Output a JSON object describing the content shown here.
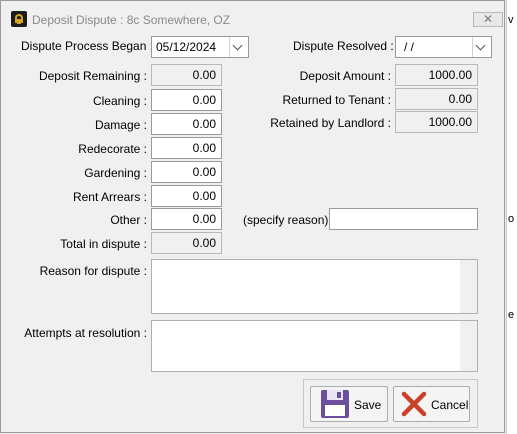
{
  "window": {
    "title": "Deposit Dispute : 8c Somewhere, OZ",
    "close_glyph": "✕"
  },
  "background": {
    "chars": [
      "v",
      "o",
      "e"
    ]
  },
  "dates": {
    "began_label": "Dispute Process Began :",
    "began_value": "05/12/2024",
    "resolved_label": "Dispute Resolved :",
    "resolved_value": " /  /"
  },
  "left": {
    "deposit_remaining": {
      "label": "Deposit Remaining :",
      "value": "0.00"
    },
    "cleaning": {
      "label": "Cleaning :",
      "value": "0.00"
    },
    "damage": {
      "label": "Damage :",
      "value": "0.00"
    },
    "redecorate": {
      "label": "Redecorate :",
      "value": "0.00"
    },
    "gardening": {
      "label": "Gardening :",
      "value": "0.00"
    },
    "rent_arrears": {
      "label": "Rent Arrears :",
      "value": "0.00"
    },
    "other": {
      "label": "Other :",
      "value": "0.00"
    },
    "total": {
      "label": "Total in dispute :",
      "value": "0.00"
    }
  },
  "right": {
    "deposit_amount": {
      "label": "Deposit Amount :",
      "value": "1000.00"
    },
    "returned": {
      "label": "Returned to Tenant :",
      "value": "0.00"
    },
    "retained": {
      "label": "Retained by Landlord :",
      "value": "1000.00"
    },
    "specify_label": "(specify reason)",
    "specify_value": ""
  },
  "memos": {
    "reason_label": "Reason for dispute :",
    "reason_value": "",
    "attempts_label": "Attempts at resolution :",
    "attempts_value": ""
  },
  "buttons": {
    "save_label": "Save",
    "cancel_label": "Cancel"
  },
  "colors": {
    "save_icon": "#6b4f9e",
    "cancel_icon": "#c8422a",
    "accent_icon": "#d4a520"
  }
}
